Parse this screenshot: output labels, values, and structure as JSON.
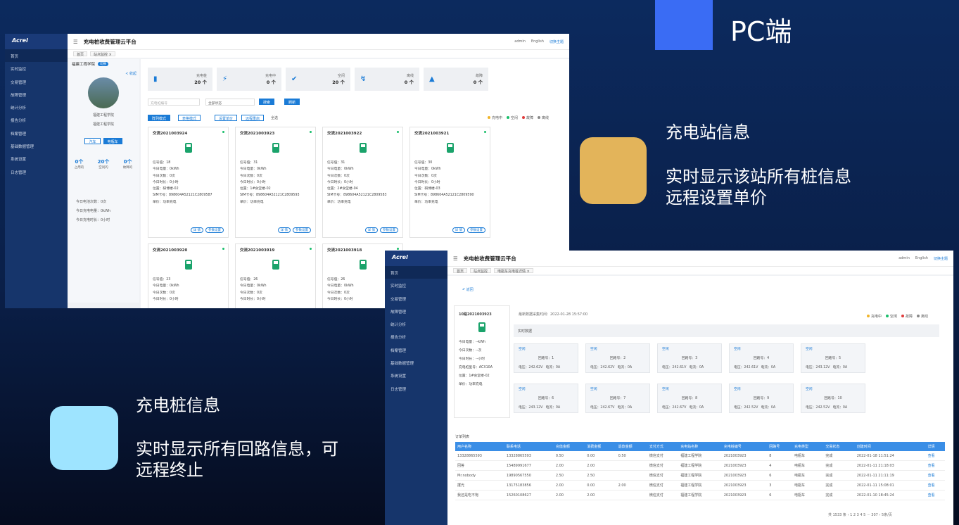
{
  "header": {
    "pc_label": "PC端"
  },
  "feature1": {
    "title": "充电站信息",
    "line1": "实时显示该站所有桩信息",
    "line2": "远程设置单价"
  },
  "feature2": {
    "title": "充电桩信息",
    "line1": "实时显示所有回路信息，可",
    "line2": "远程终止"
  },
  "app": {
    "logo": "Acrel",
    "title": "充电桩收费管理云平台",
    "admin": "admin",
    "lang": "English",
    "theme": "切换主题"
  },
  "nav": [
    "首页",
    "实时监控",
    "交易管理",
    "故障管理",
    "统计分析",
    "报告分析",
    "档案管理",
    "基础数据管理",
    "系统设置",
    "日志管理"
  ],
  "screen1": {
    "tabs": [
      "首页",
      "站点监控 ×"
    ],
    "station": {
      "name": "福建工程学院",
      "switch": "切换",
      "collapse": "< 收起",
      "photo_caption1": "福建工程学院",
      "photo_caption2": "福建工程学院",
      "car": "汽车",
      "ebike": "电瓶车",
      "counts": [
        {
          "v": "0个",
          "l": "占用的"
        },
        {
          "v": "20个",
          "l": "空闲的"
        },
        {
          "v": "0个",
          "l": "故障的"
        }
      ],
      "today": [
        "今日电池次数：0次",
        "今日充电电量：0kWh",
        "今日充电时长：0小时"
      ]
    },
    "stats": [
      {
        "icon": "pile-icon",
        "label": "充电桩",
        "value": "20 个"
      },
      {
        "icon": "bolt-icon",
        "label": "充电中",
        "value": "0 个"
      },
      {
        "icon": "check-icon",
        "label": "空闲",
        "value": "20 个"
      },
      {
        "icon": "offline-icon",
        "label": "离线",
        "value": "0 个"
      },
      {
        "icon": "warning-icon",
        "label": "故障",
        "value": "0 个"
      }
    ],
    "filter": {
      "pile_placeholder": "充电桩编号",
      "status": "全部状态",
      "search": "搜索",
      "refresh": "刷新"
    },
    "modes": {
      "list": "阵列模式",
      "table": "表格模式",
      "set_price": "设置单价",
      "remote_restart": "远程重启",
      "select_all": "全选"
    },
    "legend": [
      "充电中",
      "空闲",
      "故障",
      "离线"
    ],
    "cards": [
      {
        "id": "交流2021003924",
        "sig": "信号值：18",
        "soc": "今日电量：0kWh",
        "times": "今日次数：0次",
        "dur": "今日时长：0小时",
        "pos": "位置：研博楼-02",
        "sim": "SIM卡号：898604A52121C2809587",
        "price": "单价：功率充电"
      },
      {
        "id": "交流2021003923",
        "sig": "信号值：31",
        "soc": "今日电量：0kWh",
        "times": "今日次数：0次",
        "dur": "今日时长：0小时",
        "pos": "位置：1#食堂楼-02",
        "sim": "SIM卡号：898604A52121C2809593",
        "price": "单价：功率充电"
      },
      {
        "id": "交流2021003922",
        "sig": "信号值：31",
        "soc": "今日电量：0kWh",
        "times": "今日次数：0次",
        "dur": "今日时长：0小时",
        "pos": "位置：2#食堂楼-04",
        "sim": "SIM卡号：898604A52121C2809583",
        "price": "单价：功率充电"
      },
      {
        "id": "交流2021003921",
        "sig": "信号值：30",
        "soc": "今日电量：0kWh",
        "times": "今日次数：0次",
        "dur": "今日时长：0小时",
        "pos": "位置：研博楼-03",
        "sim": "SIM卡号：898604A52121C2809590",
        "price": "单价：功率充电"
      },
      {
        "id": "交流2021003920",
        "sig": "信号值：23",
        "soc": "今日电量：0kWh",
        "times": "今日次数：0次",
        "dur": "今日时长：0小时",
        "pos": "",
        "sim": "",
        "price": ""
      },
      {
        "id": "交流2021003919",
        "sig": "信号值：26",
        "soc": "今日电量：0kWh",
        "times": "今日次数：0次",
        "dur": "今日时长：0小时",
        "pos": "",
        "sim": "",
        "price": ""
      },
      {
        "id": "交流2021003918",
        "sig": "信号值：26",
        "soc": "今日电量：0kWh",
        "times": "今日次数：0次",
        "dur": "今日时长：0小时",
        "pos": "",
        "sim": "",
        "price": ""
      }
    ],
    "detail": "详 情",
    "param": "参数设置"
  },
  "screen2": {
    "tabs": [
      "首页",
      "站点监控",
      "电瓶车充电桩详情 ×"
    ],
    "back": "返回",
    "pile": {
      "id": "10路2021003923",
      "lines": [
        "今日电量：--kWh",
        "今日次数：--次",
        "今日时长：--小时",
        "充电桩型号：ACX10A",
        "位置：1#食堂楼-02",
        "单价：功率充电"
      ]
    },
    "update": "最新数据采集时间：2022-01-28 15:57:00",
    "legend": [
      "充电中",
      "空闲",
      "故障",
      "离线"
    ],
    "realtime": "实时数据",
    "loops": [
      {
        "s": "空闲",
        "n": "回路号：1",
        "vol": "电压：242.62V",
        "cur": "电流：0A"
      },
      {
        "s": "空闲",
        "n": "回路号：2",
        "vol": "电压：242.62V",
        "cur": "电流：0A"
      },
      {
        "s": "空闲",
        "n": "回路号：3",
        "vol": "电压：242.61V",
        "cur": "电流：0A"
      },
      {
        "s": "空闲",
        "n": "回路号：4",
        "vol": "电压：242.61V",
        "cur": "电流：0A"
      },
      {
        "s": "空闲",
        "n": "回路号：5",
        "vol": "电压：243.12V",
        "cur": "电流：0A"
      },
      {
        "s": "空闲",
        "n": "回路号：6",
        "vol": "电压：243.12V",
        "cur": "电流：0A"
      },
      {
        "s": "空闲",
        "n": "回路号：7",
        "vol": "电压：242.67V",
        "cur": "电流：0A"
      },
      {
        "s": "空闲",
        "n": "回路号：8",
        "vol": "电压：242.67V",
        "cur": "电流：0A"
      },
      {
        "s": "空闲",
        "n": "回路号：9",
        "vol": "电压：242.52V",
        "cur": "电流：0A"
      },
      {
        "s": "空闲",
        "n": "回路号：10",
        "vol": "电压：242.52V",
        "cur": "电流：0A"
      }
    ],
    "orders_title": "订单列表",
    "columns": [
      "用户名称",
      "联系电话",
      "充值金额",
      "消费金额",
      "退款金额",
      "支付方式",
      "充电站名称",
      "充电桩编号",
      "回路号",
      "充电类型",
      "交易状态",
      "创建时间",
      "详情"
    ],
    "rows": [
      [
        "13328865593",
        "13328865593",
        "0.50",
        "0.00",
        "0.50",
        "微信支付",
        "福建工程学院",
        "2021003923",
        "8",
        "电瓶车",
        "完成",
        "2022-01-18 11:51:24",
        "查看"
      ],
      [
        "回答",
        "15489991677",
        "2.00",
        "2.00",
        "",
        "微信支付",
        "福建工程学院",
        "2021003923",
        "4",
        "电瓶车",
        "完成",
        "2022-01-11 21:18:03",
        "查看"
      ],
      [
        "Mr.nobody",
        "19890567550",
        "2.50",
        "2.50",
        "",
        "微信支付",
        "福建工程学院",
        "2021003923",
        "6",
        "电瓶车",
        "完成",
        "2022-01-11 21:11:19",
        "查看"
      ],
      [
        "攫光",
        "13175183856",
        "2.00",
        "0.00",
        "2.00",
        "微信支付",
        "福建工程学院",
        "2021003923",
        "3",
        "电瓶车",
        "完成",
        "2022-01-11 15:08:01",
        "查看"
      ],
      [
        "我还是吃不饱",
        "15260108627",
        "2.00",
        "2.00",
        "",
        "微信支付",
        "福建工程学院",
        "2021003923",
        "6",
        "电瓶车",
        "完成",
        "2022-01-10 18:45:24",
        "查看"
      ]
    ],
    "pager": "共 1533 条  ‹ 1 2 3 4 5 ··· 307 ›  5条/页"
  }
}
